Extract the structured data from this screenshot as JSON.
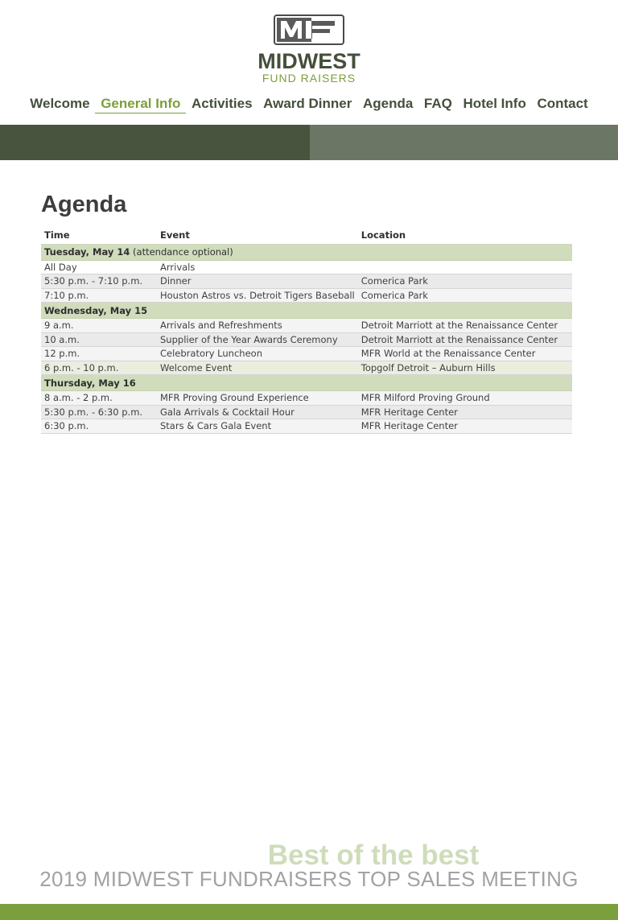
{
  "brand": {
    "name": "MIDWEST",
    "subtitle": "FUND RAISERS",
    "logo_letters": "MF",
    "colors": {
      "dark_green": "#454f3b",
      "accent_green": "#7b9f3c",
      "row_green": "#d1dcbc"
    }
  },
  "nav": {
    "items": [
      {
        "label": "Welcome"
      },
      {
        "label": "General Info"
      },
      {
        "label": "Activities"
      },
      {
        "label": "Award Dinner"
      },
      {
        "label": "Agenda"
      },
      {
        "label": "FAQ"
      },
      {
        "label": "Hotel Info"
      },
      {
        "label": "Contact"
      }
    ],
    "active": "General Info"
  },
  "page": {
    "title": "Agenda"
  },
  "table": {
    "headers": {
      "time": "Time",
      "event": "Event",
      "location": "Location"
    },
    "days": [
      {
        "label": "Tuesday, May 14",
        "note": " (attendance optional)",
        "rows": [
          {
            "time": "All Day",
            "event": "Arrivals",
            "location": ""
          },
          {
            "time": "5:30 p.m. - 7:10 p.m.",
            "event": "Dinner",
            "location": "Comerica Park"
          },
          {
            "time": "7:10 p.m.",
            "event": "Houston Astros vs. Detroit Tigers Baseball",
            "location": "Comerica Park"
          }
        ]
      },
      {
        "label": "Wednesday, May 15",
        "note": "",
        "rows": [
          {
            "time": "9 a.m.",
            "event": "Arrivals and Refreshments",
            "location": "Detroit Marriott at the Renaissance Center"
          },
          {
            "time": "10 a.m.",
            "event": "Supplier of the Year Awards Ceremony",
            "location": "Detroit Marriott at the Renaissance Center"
          },
          {
            "time": "12 p.m.",
            "event": "Celebratory Luncheon",
            "location": "MFR World at the Renaissance Center"
          },
          {
            "time": "6 p.m. - 10 p.m.",
            "event": "Welcome Event",
            "location": "Topgolf Detroit – Auburn Hills"
          }
        ]
      },
      {
        "label": "Thursday, May 16",
        "note": "",
        "rows": [
          {
            "time": "8 a.m. - 2 p.m.",
            "event": "MFR Proving Ground Experience",
            "location": "MFR Milford Proving Ground"
          },
          {
            "time": "5:30 p.m. - 6:30 p.m.",
            "event": "Gala Arrivals & Cocktail Hour",
            "location": "MFR Heritage Center"
          },
          {
            "time": "6:30 p.m.",
            "event": "Stars & Cars Gala Event",
            "location": "MFR Heritage Center"
          }
        ]
      }
    ]
  },
  "footer": {
    "tagline": "Best of the best",
    "meeting": "2019 MIDWEST FUNDRAISERS TOP SALES MEETING"
  }
}
